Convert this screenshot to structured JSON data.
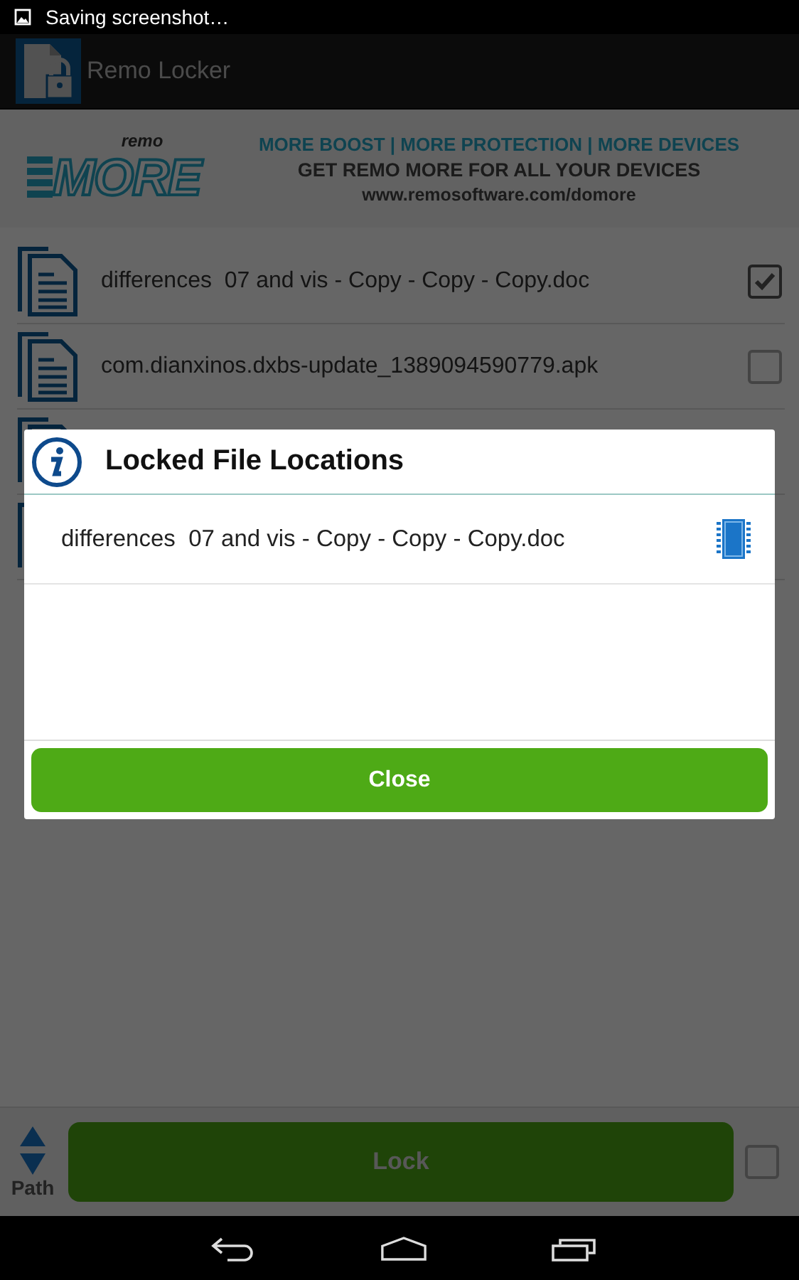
{
  "status_bar": {
    "notification": "Saving screenshot…"
  },
  "action_bar": {
    "title": "Remo Locker"
  },
  "banner": {
    "logo_small": "remo",
    "logo_big": "MORE",
    "tagline": "MORE BOOST | MORE PROTECTION | MORE DEVICES",
    "headline": "GET REMO MORE FOR ALL YOUR DEVICES",
    "url": "www.remosoftware.com/domore"
  },
  "files": [
    {
      "kind": "file",
      "name": "differences  07 and vis - Copy - Copy - Copy.doc",
      "checked": true
    },
    {
      "kind": "file",
      "name": "com.dianxinos.dxbs-update_1389094590779.apk",
      "checked": false
    },
    {
      "kind": "file"
    },
    {
      "kind": "file"
    }
  ],
  "bottom_bar": {
    "path_label": "Path",
    "lock_button": "Lock",
    "checked": false
  },
  "dialog": {
    "title": "Locked File Locations",
    "items": [
      {
        "name": "differences  07 and vis - Copy - Copy - Copy.doc"
      }
    ],
    "close_button": "Close"
  }
}
